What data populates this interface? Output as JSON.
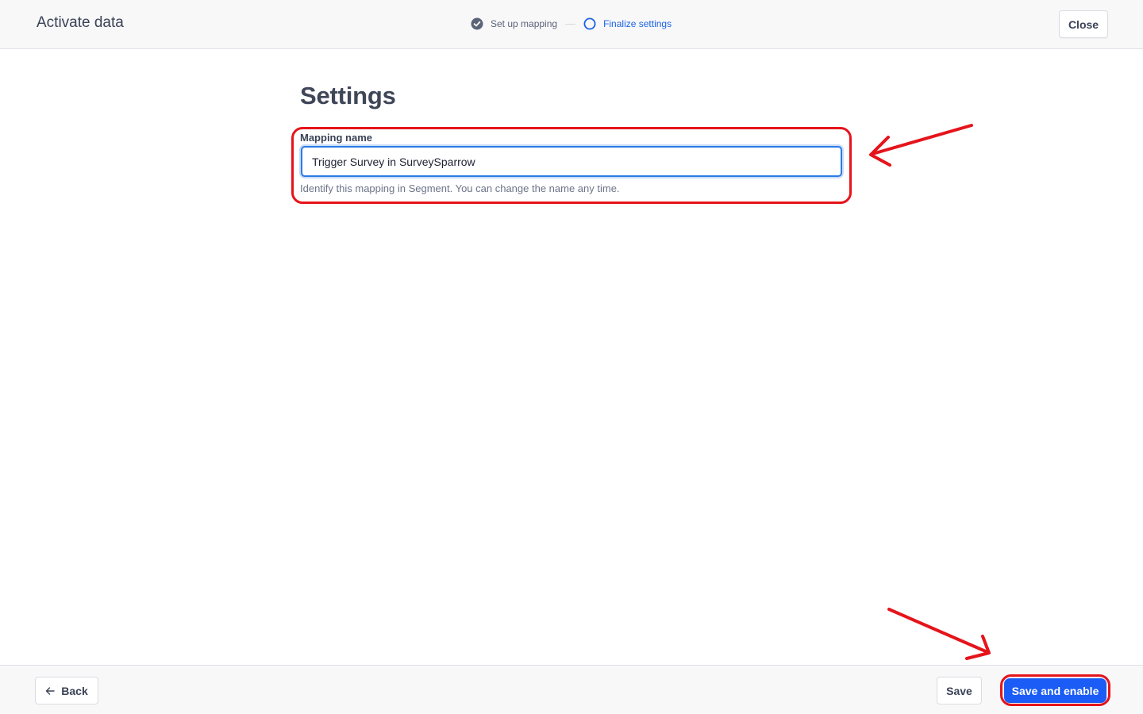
{
  "header": {
    "title": "Activate data",
    "steps": [
      {
        "label": "Set up mapping",
        "state": "complete",
        "icon": "check-circle-icon"
      },
      {
        "label": "Finalize settings",
        "state": "current",
        "icon": "circle-outline-icon"
      }
    ],
    "close_label": "Close"
  },
  "main": {
    "title": "Settings",
    "mapping_name": {
      "label": "Mapping name",
      "value": "Trigger Survey in SurveySparrow",
      "helper": "Identify this mapping in Segment. You can change the name any time."
    }
  },
  "footer": {
    "back_label": "Back",
    "save_label": "Save",
    "save_enable_label": "Save and enable"
  },
  "colors": {
    "accent": "#1a5cf5",
    "step_active": "#1b62e6",
    "annotation": "#e5141b"
  }
}
